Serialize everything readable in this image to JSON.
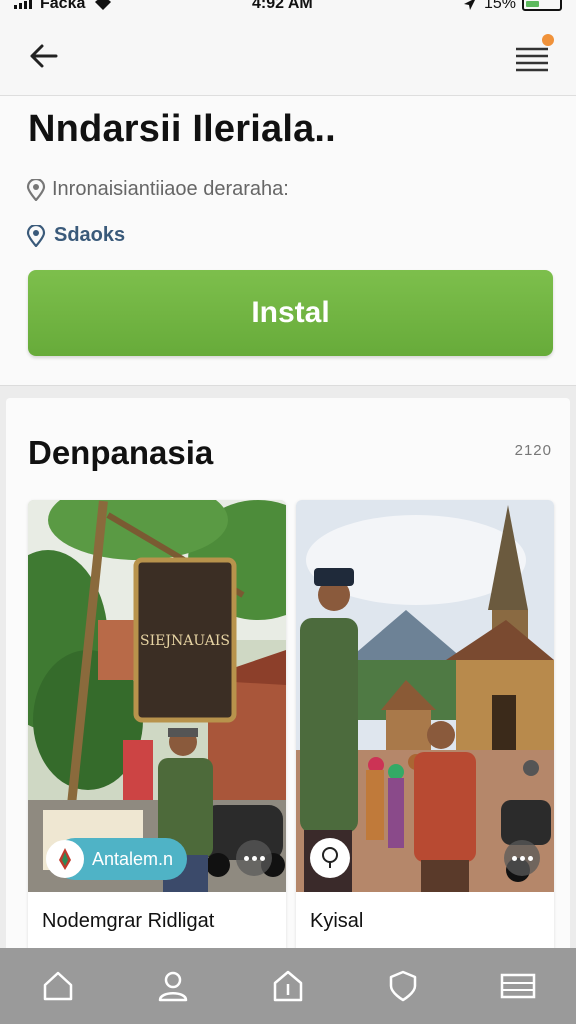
{
  "status_bar": {
    "carrier": "Facka",
    "time": "4:92 AM",
    "battery": "15%",
    "battery_level": 0.15,
    "icons": [
      "signal-icon",
      "wifi-icon",
      "location-arrow-icon",
      "battery-icon"
    ]
  },
  "header": {
    "back_icon": "arrow-left-icon",
    "menu_icon": "hamburger-menu-icon",
    "notification_color": "#f0923a"
  },
  "app": {
    "title": "Nndarsii Ileriala..",
    "subtitle": "Inronaisiantiiaoe deraraha:",
    "location": "Sdaoks",
    "install_label": "Instal",
    "install_color": "#6cb040"
  },
  "section": {
    "title": "Denpanasia",
    "count": "2120"
  },
  "cards": [
    {
      "badge": "Antalem.n",
      "caption": "Nodemgrar Ridligat",
      "sign_text": "SIEJNAUAIS"
    },
    {
      "caption": "Kyisal"
    }
  ],
  "bottom_nav": {
    "items": [
      "home-icon",
      "profile-icon",
      "apps-icon",
      "shield-icon",
      "menu-icon"
    ]
  }
}
